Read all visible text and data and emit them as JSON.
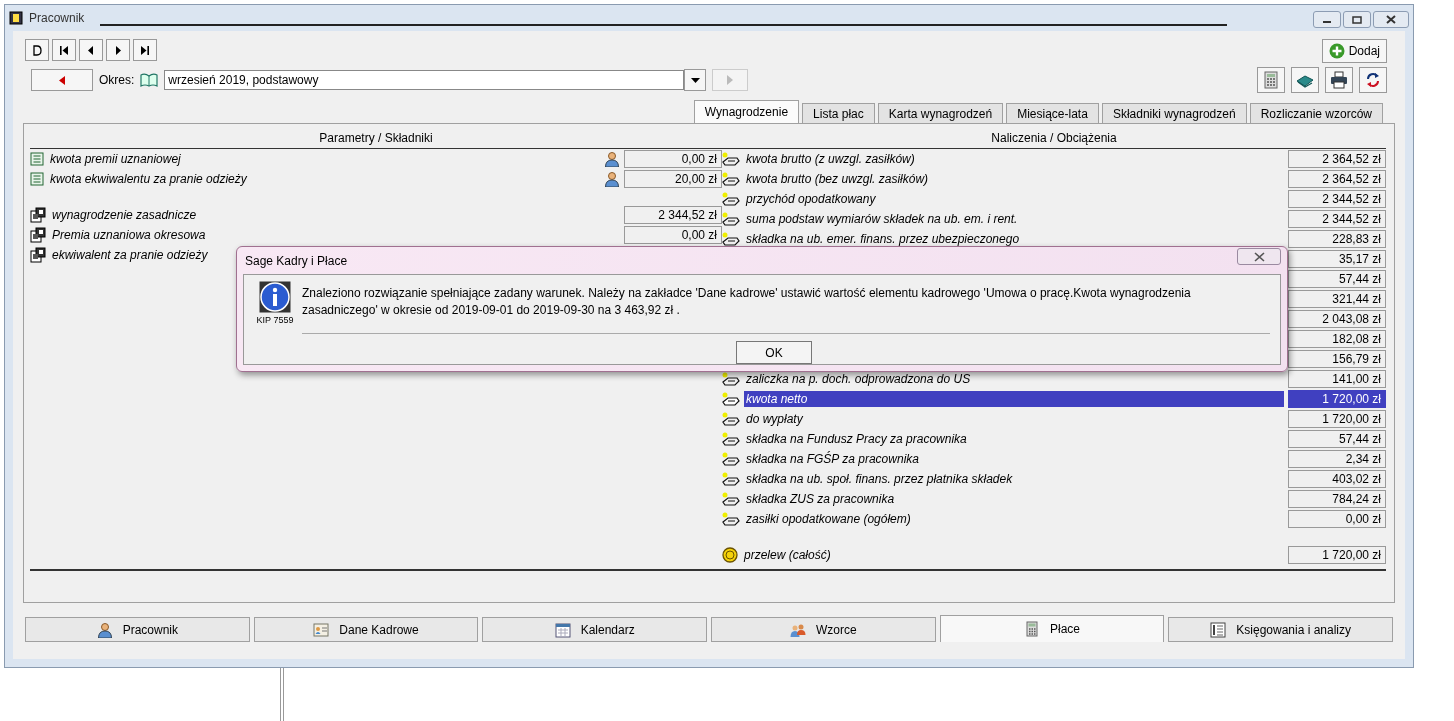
{
  "window": {
    "title": "Pracownik"
  },
  "toolbar": {
    "period_label": "Okres:",
    "period": {
      "value": "wrzesień 2019, podstawowy"
    },
    "next_disabled": true,
    "add_button": "Dodaj"
  },
  "tabs": [
    {
      "label": "Wynagrodzenie",
      "selected": true
    },
    {
      "label": "Lista płac",
      "selected": false
    },
    {
      "label": "Karta wynagrodzeń",
      "selected": false
    },
    {
      "label": "Miesiące-lata",
      "selected": false
    },
    {
      "label": "Składniki wynagrodzeń",
      "selected": false
    },
    {
      "label": "Rozliczanie wzorców",
      "selected": false
    }
  ],
  "left": {
    "header": "Parametry / Składniki",
    "rows": [
      {
        "kind": "param",
        "label": "kwota premii uznaniowej",
        "value": "0,00 zł"
      },
      {
        "kind": "param",
        "label": "kwota ekwiwalentu za pranie odzieży",
        "value": "20,00 zł"
      },
      {
        "kind": "spacer"
      },
      {
        "kind": "component",
        "label": "wynagrodzenie zasadnicze",
        "value": "2 344,52 zł"
      },
      {
        "kind": "component",
        "label": "Premia uznaniowa okresowa",
        "value": "0,00 zł"
      },
      {
        "kind": "component",
        "label": "ekwiwalent za pranie odzieży"
      }
    ]
  },
  "right": {
    "header": "Naliczenia / Obciążenia",
    "rows": [
      {
        "kind": "charge",
        "label": "kwota brutto (z uwzgl. zasiłków)",
        "value": "2 364,52 zł",
        "selected": false
      },
      {
        "kind": "charge",
        "label": "kwota brutto (bez uwzgl. zasiłków)",
        "value": "2 364,52 zł",
        "selected": false
      },
      {
        "kind": "charge",
        "label": "przychód opodatkowany",
        "value": "2 344,52 zł",
        "selected": false
      },
      {
        "kind": "charge",
        "label": "suma podstaw wymiarów składek na ub. em. i rent.",
        "value": "2 344,52 zł",
        "selected": false
      },
      {
        "kind": "charge",
        "label": "składka na ub. emer. finans. przez ubezpieczonego",
        "value": "228,83 zł",
        "selected": false
      },
      {
        "kind": "charge",
        "value": "35,17 zł",
        "selected": false
      },
      {
        "kind": "charge",
        "value": "57,44 zł",
        "selected": false
      },
      {
        "kind": "charge",
        "value": "321,44 zł",
        "selected": false
      },
      {
        "kind": "charge",
        "value": "2 043,08 zł",
        "selected": false
      },
      {
        "kind": "charge",
        "value": "182,08 zł",
        "selected": false
      },
      {
        "kind": "charge",
        "value": "156,79 zł",
        "selected": false
      },
      {
        "kind": "charge",
        "label": "zaliczka na p. doch. odprowadzona do US",
        "value": "141,00 zł",
        "selected": false
      },
      {
        "kind": "charge",
        "label": "kwota netto",
        "value": "1 720,00 zł",
        "selected": true
      },
      {
        "kind": "charge",
        "label": "do wypłaty",
        "value": "1 720,00 zł",
        "selected": false
      },
      {
        "kind": "charge",
        "label": "składka na Fundusz Pracy za pracownika",
        "value": "57,44 zł",
        "selected": false
      },
      {
        "kind": "charge",
        "label": "składka na FGŚP za pracownika",
        "value": "2,34 zł",
        "selected": false
      },
      {
        "kind": "charge",
        "label": "składka na ub. społ. finans. przez płatnika składek",
        "value": "403,02 zł",
        "selected": false
      },
      {
        "kind": "charge",
        "label": "składka ZUS za pracownika",
        "value": "784,24 zł",
        "selected": false
      },
      {
        "kind": "charge",
        "label": "zasiłki opodatkowane (ogółem)",
        "value": "0,00 zł",
        "selected": false
      },
      {
        "kind": "spacer"
      },
      {
        "kind": "transfer",
        "label": "przelew (całość)",
        "value": "1 720,00 zł",
        "selected": false
      }
    ]
  },
  "bottom_tabs": [
    {
      "label": "Pracownik",
      "selected": false
    },
    {
      "label": "Dane Kadrowe",
      "selected": false
    },
    {
      "label": "Kalendarz",
      "selected": false
    },
    {
      "label": "Wzorce",
      "selected": false
    },
    {
      "label": "Płace",
      "selected": true
    },
    {
      "label": "Księgowania i analizy",
      "selected": false
    }
  ],
  "dialog": {
    "title": "Sage Kadry i Płace",
    "code": "KIP 7559",
    "message": "Znaleziono rozwiązanie spełniające zadany warunek. Należy na zakładce 'Dane kadrowe' ustawić wartość elementu kadrowego 'Umowa o pracę.Kwota wynagrodzenia zasadniczego' w okresie od 2019-09-01 do 2019-09-30 na 3 463,92 zł .",
    "button": "OK"
  }
}
